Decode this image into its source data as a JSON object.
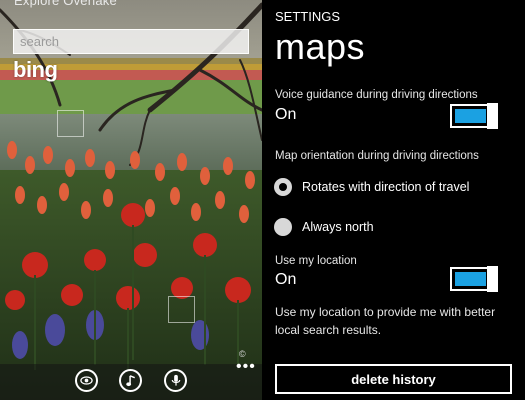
{
  "left_panel": {
    "caption": "Explore Overlake",
    "search_placeholder": "search",
    "logo_text": "bing",
    "copyright": "©",
    "more_dots": "•••",
    "appbar_icons": [
      "eye-icon",
      "music-note-icon",
      "microphone-icon"
    ]
  },
  "settings": {
    "header": "SETTINGS",
    "title": "maps",
    "voice_guidance": {
      "label": "Voice guidance during driving directions",
      "value": "On",
      "on": true
    },
    "orientation": {
      "label": "Map orientation during driving directions",
      "options": [
        {
          "label": "Rotates with direction of travel",
          "selected": true
        },
        {
          "label": "Always north",
          "selected": false
        }
      ]
    },
    "use_location": {
      "label": "Use my location",
      "value": "On",
      "on": true,
      "description": "Use my location to provide me with better local search results."
    },
    "delete_history_label": "delete history"
  },
  "colors": {
    "accent": "#1ba1e2",
    "background": "#000000",
    "text": "#ffffff"
  }
}
